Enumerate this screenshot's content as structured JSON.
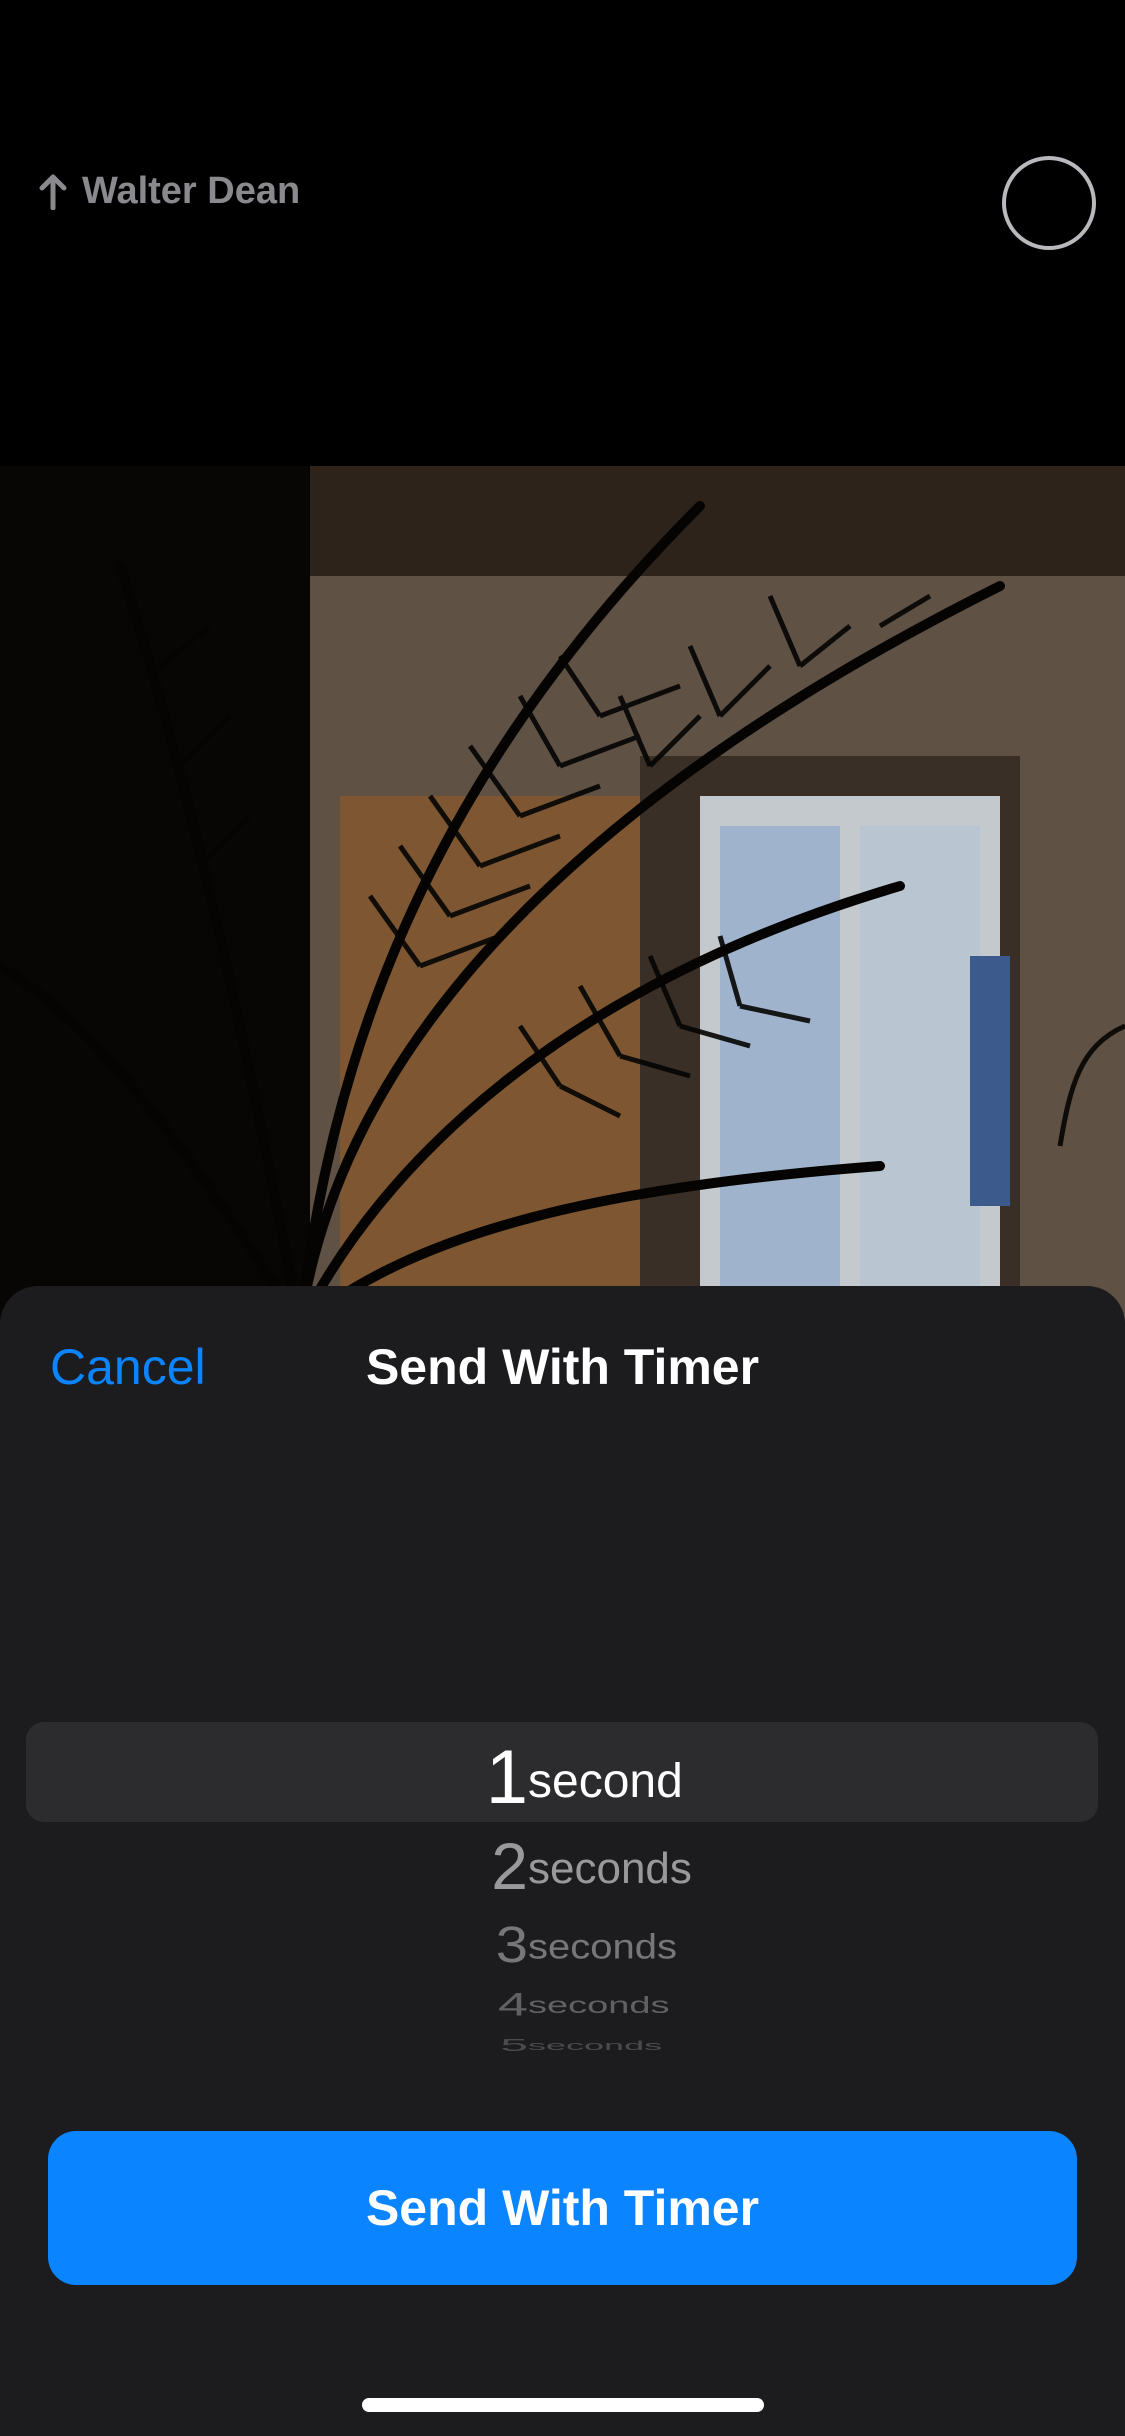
{
  "header": {
    "recipient_name": "Walter Dean",
    "recipient_icon": "arrow-up-icon",
    "timer_icon": "circle-icon"
  },
  "photo": {
    "description_icon": "photo-preview"
  },
  "sheet": {
    "cancel_label": "Cancel",
    "title": "Send With Timer",
    "picker": {
      "selected_index": 0,
      "rows": [
        {
          "number": "1",
          "unit": "second"
        },
        {
          "number": "2",
          "unit": "seconds"
        },
        {
          "number": "3",
          "unit": "seconds"
        },
        {
          "number": "4",
          "unit": "seconds"
        },
        {
          "number": "5",
          "unit": "seconds"
        }
      ]
    },
    "send_button_label": "Send With Timer"
  },
  "colors": {
    "accent": "#0a84ff",
    "sheet_background": "#1c1c1e",
    "picker_highlight": "#2c2c2e"
  }
}
